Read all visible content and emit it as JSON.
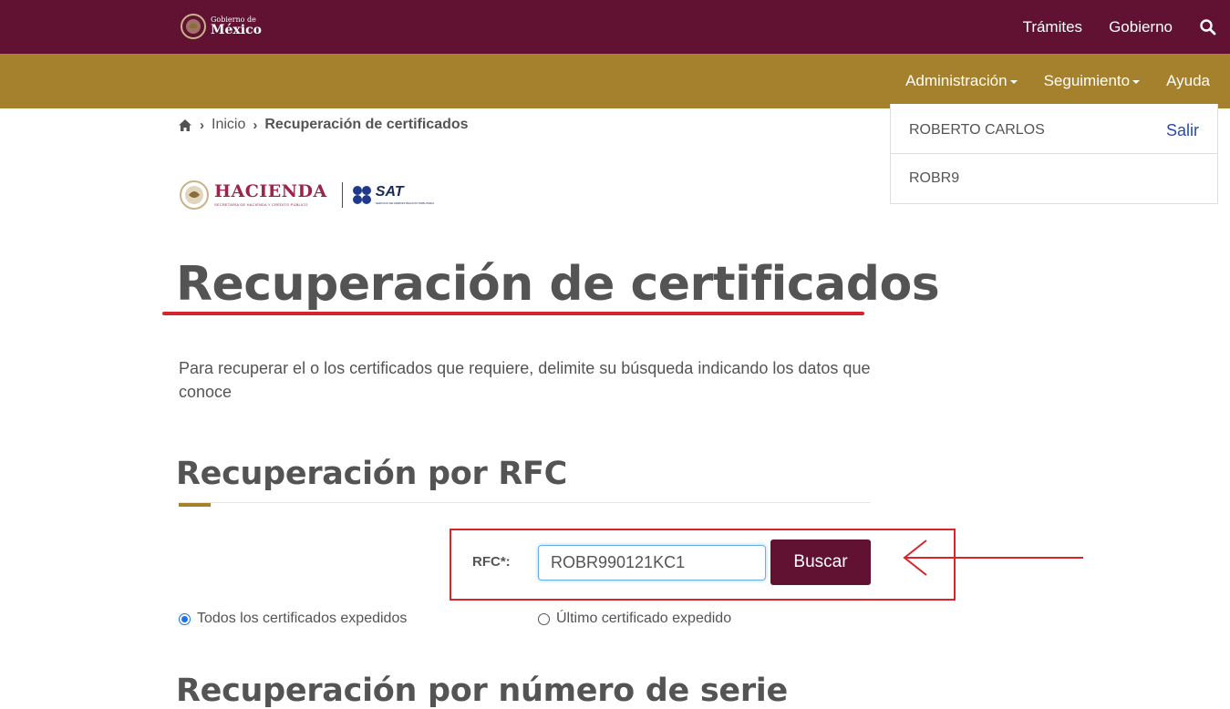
{
  "header": {
    "logo_small": "Gobierno de",
    "logo_big": "México",
    "nav": [
      "Trámites",
      "Gobierno"
    ],
    "search_icon": "search-icon"
  },
  "subnav": {
    "items": [
      {
        "label": "Administración",
        "has_caret": true
      },
      {
        "label": "Seguimiento",
        "has_caret": true
      },
      {
        "label": "Ayuda",
        "has_caret": false
      }
    ]
  },
  "breadcrumb": {
    "home_icon": "home-icon",
    "inicio": "Inicio",
    "current": "Recuperación de certificados"
  },
  "user": {
    "name": "ROBERTO CARLOS",
    "logout": "Salir",
    "rfc_short": "ROBR9"
  },
  "brand": {
    "hacienda": "HACIENDA",
    "hacienda_sub": "SECRETARÍA DE HACIENDA Y CRÉDITO PÚBLICO",
    "sat": "SAT",
    "sat_sub": "SERVICIO DE ADMINISTRACIÓN TRIBUTARIA"
  },
  "main": {
    "title": "Recuperación de certificados",
    "intro": "Para recuperar el o los certificados que requiere, delimite su búsqueda indicando los datos que conoce",
    "section_rfc": "Recuperación por RFC",
    "rfc_label": "RFC*:",
    "rfc_value": "ROBR990121KC1",
    "search_button": "Buscar",
    "radio_all": "Todos los certificados expedidos",
    "radio_last": "Último certificado expedido",
    "radio_selected": "all",
    "section_serial": "Recuperación por número de serie"
  },
  "colors": {
    "top_bar": "#611232",
    "sub_bar": "#a5802d",
    "highlight": "#d6252b",
    "button": "#611232"
  }
}
